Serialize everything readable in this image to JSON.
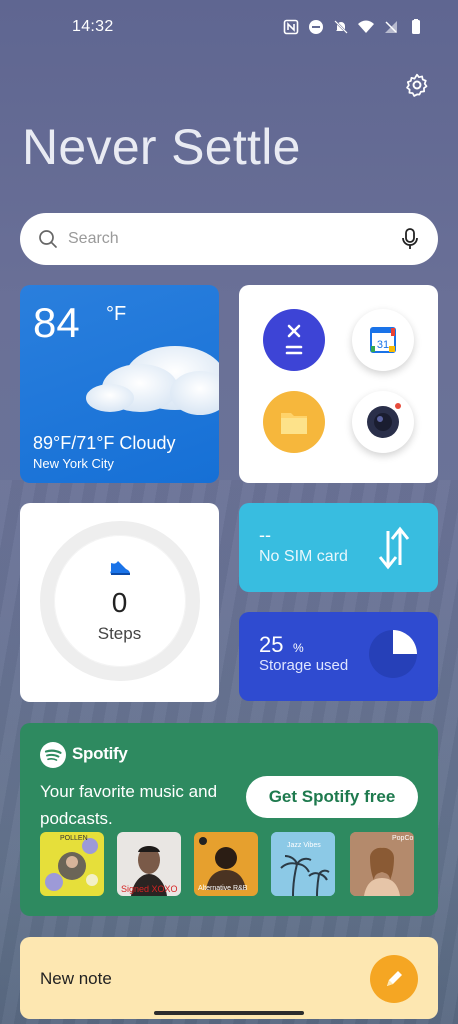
{
  "status_bar": {
    "time": "14:32",
    "icons": [
      "nfc-icon",
      "dnd-icon",
      "bell-off-icon",
      "wifi-icon",
      "no-sim-icon",
      "battery-icon"
    ]
  },
  "header": {
    "title": "Never Settle",
    "settings_icon": "gear-icon"
  },
  "search": {
    "placeholder": "Search"
  },
  "weather": {
    "temperature": "84",
    "unit": "°F",
    "description": "89°F/71°F Cloudy",
    "city": "New York City"
  },
  "apps": [
    {
      "name": "calculator-icon",
      "color": "#3d44d6"
    },
    {
      "name": "calendar-icon",
      "label": "31",
      "color": "#ffffff"
    },
    {
      "name": "files-icon",
      "color": "#f6b73c"
    },
    {
      "name": "camera-icon",
      "color": "#ffffff"
    }
  ],
  "steps": {
    "count": "0",
    "label": "Steps"
  },
  "sim": {
    "dash": "--",
    "status": "No SIM card"
  },
  "storage": {
    "percent": "25",
    "percent_sign": "%",
    "label": "Storage used",
    "fraction": 0.25
  },
  "spotify": {
    "brand": "Spotify",
    "tagline": "Your favorite music and podcasts.",
    "button": "Get Spotify free",
    "albums": [
      {
        "title": "POLLEN",
        "color": "#e6df3a"
      },
      {
        "title": "Signed XOXO",
        "color": "#e9e6e3"
      },
      {
        "title": "Alternative R&B",
        "color": "#e6a02e"
      },
      {
        "title": "Jazz Vibes",
        "color": "#7ec3e0"
      },
      {
        "title": "PopCo",
        "color": "#c39a7c"
      }
    ]
  },
  "note": {
    "label": "New note"
  },
  "colors": {
    "weather_card": "#1670d6",
    "sim_card": "#38bde0",
    "storage_card": "#2f4bd0",
    "spotify_card": "#2e8a60",
    "note_card": "#fde7b1",
    "note_button": "#f5a623"
  }
}
